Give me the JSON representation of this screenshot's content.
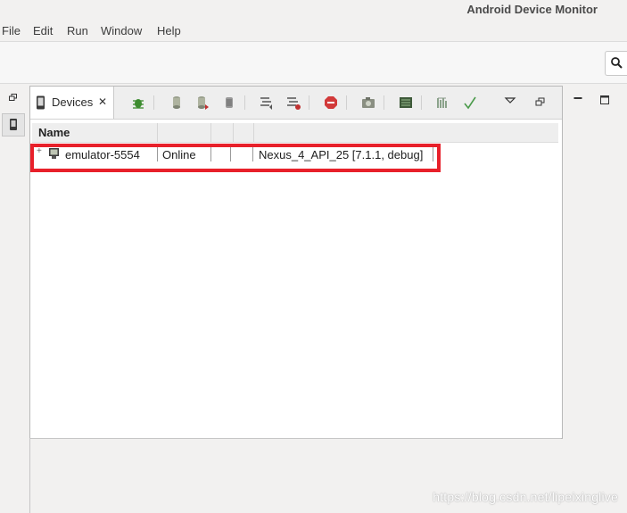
{
  "window": {
    "title": "Android Device Monitor"
  },
  "menu": [
    "File",
    "Edit",
    "Run",
    "Window",
    "Help"
  ],
  "toolbar": {
    "search_icon": "search-icon"
  },
  "devices_view": {
    "tab_label": "Devices",
    "tab_icon": "phone-icon",
    "toolbar_icons": [
      "debug-process-icon",
      "update-heap-icon",
      "dump-hprof-icon",
      "cause-gc-icon",
      "update-threads-icon",
      "start-method-profiling-icon",
      "stop-process-icon",
      "screen-capture-icon",
      "dump-view-hierarchy-icon",
      "systrace-icon",
      "opengl-trace-icon",
      "view-menu-icon",
      "restore-icon"
    ],
    "columns": [
      "Name",
      "",
      "",
      "",
      ""
    ],
    "rows": [
      {
        "name": "emulator-5554",
        "status": "Online",
        "avd": "Nexus_4_API_25 [7.1.1, debug]"
      }
    ]
  },
  "colors": {
    "highlight_border": "#e8202a",
    "background": "#f2f1f0"
  },
  "watermark": "https://blog.csdn.net/lipeixinglive"
}
